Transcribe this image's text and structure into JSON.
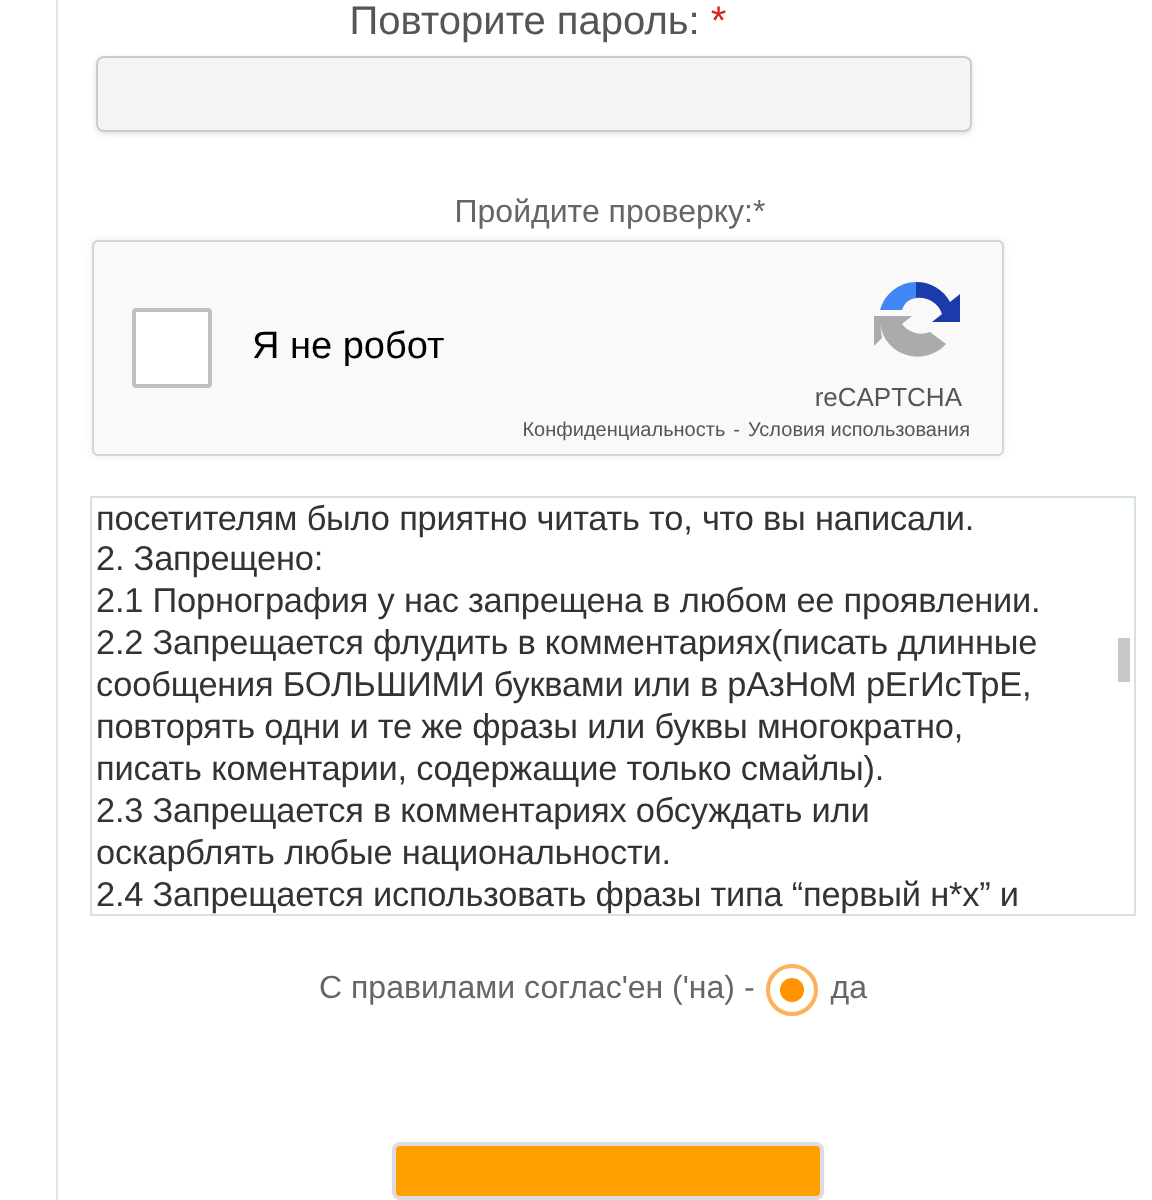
{
  "password_repeat": {
    "label": "Повторите пароль:",
    "required_mark": "*"
  },
  "captcha_section": {
    "label": "Пройдите проверку:*"
  },
  "captcha": {
    "checked": false,
    "label": "Я не робот",
    "brand": "reCAPTCHA",
    "privacy_link": "Конфиденциальность",
    "separator": "-",
    "terms_link": "Условия использования"
  },
  "rules_text": {
    "lines": [
      "посетителям было приятно читать то, что вы написали.",
      "2. Запрещено:",
      "2.1 Порнография у нас запрещена в любом ее проявлении.",
      "2.2 Запрещается флудить в комментариях(писать длинные",
      "сообщения БОЛЬШИМИ буквами или в рАзНоМ рЕгИсТрЕ,",
      "повторять одни и те же фразы или буквы многократно,",
      "писать коментарии, содержащие только смайлы).",
      "2.3 Запрещается в комментариях обсуждать или",
      "оскарблять любые национальности.",
      "2.4 Запрещается использовать фразы типа “первый н*х” и"
    ]
  },
  "agreement": {
    "label": "С правилами соглас'ен ('на) -",
    "option": {
      "label": "да",
      "selected": true
    }
  },
  "submit_button": {
    "kind": "button"
  }
}
